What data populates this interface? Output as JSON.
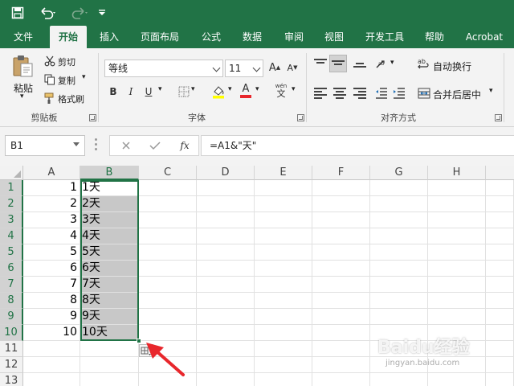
{
  "tabs": [
    "文件",
    "开始",
    "插入",
    "页面布局",
    "公式",
    "数据",
    "审阅",
    "视图",
    "开发工具",
    "帮助",
    "Acrobat"
  ],
  "ribbon": {
    "paste_label": "粘贴",
    "cut_label": "剪切",
    "copy_label": "复制",
    "format_painter_label": "格式刷",
    "clipboard_group": "剪贴板",
    "font_name": "等线",
    "font_size": "11",
    "bold": "B",
    "italic": "I",
    "underline": "U",
    "font_group": "字体",
    "wrap_text_label": "自动换行",
    "merge_center_label": "合并后居中",
    "alignment_group": "对齐方式",
    "grow_font": "A",
    "shrink_font": "A",
    "font_color_letter": "A",
    "phonetic_label": "wén"
  },
  "formula_bar": {
    "name_box": "B1",
    "formula": "=A1&\"天\"",
    "fx": "fx"
  },
  "columns": [
    "A",
    "B",
    "C",
    "D",
    "E",
    "F",
    "G",
    "H"
  ],
  "rows": [
    "1",
    "2",
    "3",
    "4",
    "5",
    "6",
    "7",
    "8",
    "9",
    "10",
    "11",
    "12",
    "13"
  ],
  "col_a_values": [
    "1",
    "2",
    "3",
    "4",
    "5",
    "6",
    "7",
    "8",
    "9",
    "10"
  ],
  "col_b_values": [
    "1天",
    "2天",
    "3天",
    "4天",
    "5天",
    "6天",
    "7天",
    "8天",
    "9天",
    "10天"
  ],
  "watermark": {
    "brand": "Baidu经验",
    "url": "jingyan.baidu.com"
  },
  "colors": {
    "excel_green": "#217346",
    "highlight_gray": "#c8c8c8",
    "arrow_red": "#e8272c"
  }
}
